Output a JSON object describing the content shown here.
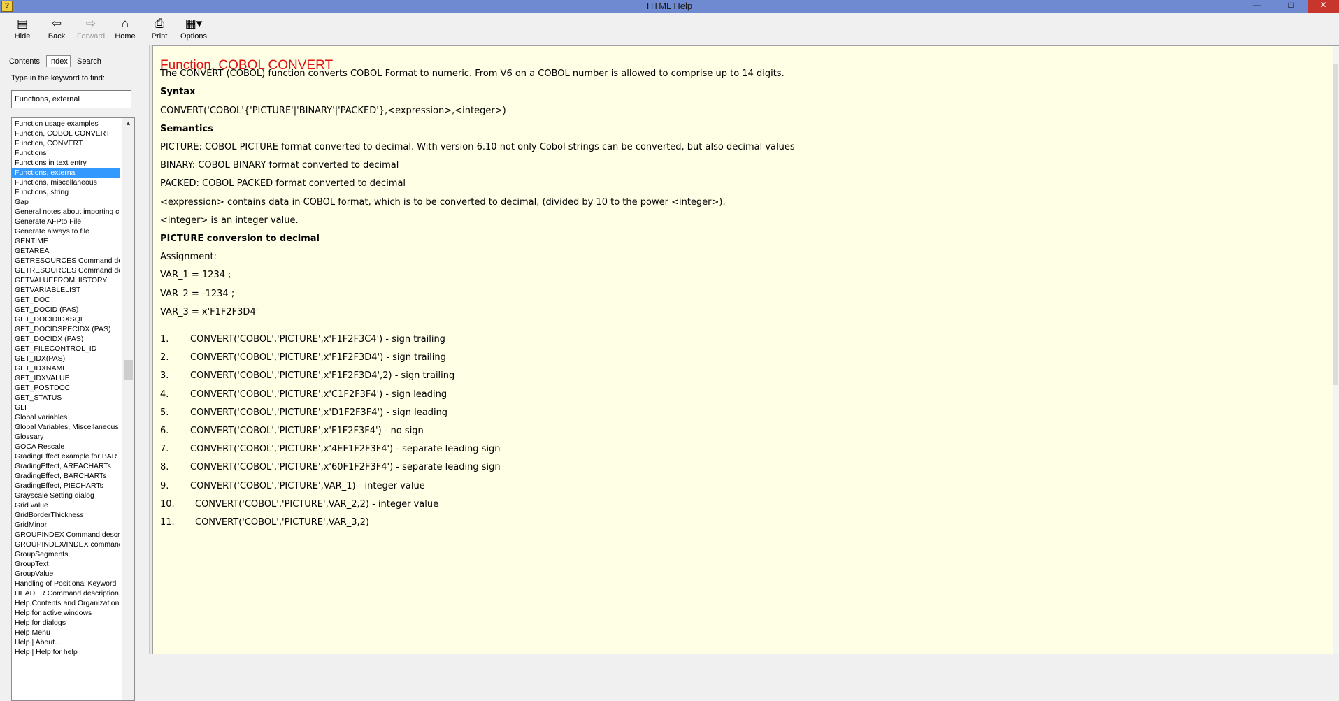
{
  "window": {
    "title": "HTML Help"
  },
  "toolbar": {
    "buttons": [
      "Hide",
      "Back",
      "Forward",
      "Home",
      "Print",
      "Options"
    ]
  },
  "tabs": [
    "Contents",
    "Index",
    "Search"
  ],
  "index": {
    "prompt": "Type in the keyword to find:",
    "keyword": "Functions, external",
    "items": [
      "Function usage examples",
      "Function, COBOL CONVERT",
      "Function, CONVERT",
      "Functions",
      "Functions in text entry",
      "Functions, external",
      "Functions, miscellaneous",
      "Functions, string",
      "Gap",
      "General notes about importing c",
      "Generate AFPto File",
      "Generate always to file",
      "GENTIME",
      "GETAREA",
      "GETRESOURCES Command def",
      "GETRESOURCES Command des",
      "GETVALUEFROMHISTORY",
      "GETVARIABLELIST",
      "GET_DOC",
      "GET_DOCID (PAS)",
      "GET_DOCIDIDXSQL",
      "GET_DOCIDSPECIDX (PAS)",
      "GET_DOCIDX (PAS)",
      "GET_FILECONTROL_ID",
      "GET_IDX(PAS)",
      "GET_IDXNAME",
      "GET_IDXVALUE",
      "GET_POSTDOC",
      "GET_STATUS",
      "GLI",
      "Global variables",
      "Global Variables, Miscellaneous",
      "Glossary",
      "GOCA Rescale",
      "GradingEffect example for BAR",
      "GradingEffect, AREACHARTs",
      "GradingEffect, BARCHARTs",
      "GradingEffect, PIECHARTs",
      "Grayscale Setting dialog",
      "Grid value",
      "GridBorderThickness",
      "GridMinor",
      "GROUPINDEX Command descrip",
      "GROUPINDEX/INDEX command d",
      "GroupSegments",
      "GroupText",
      "GroupValue",
      "Handling of Positional Keyword",
      "HEADER Command description",
      "Help Contents and Organization",
      "Help for active windows",
      "Help for dialogs",
      "Help Menu",
      "Help | About...",
      "Help | Help for help"
    ],
    "selected": "Functions, external"
  },
  "content": {
    "title": "Function, COBOL CONVERT",
    "intro": "The CONVERT (COBOL) function converts COBOL Format to numeric. From V6 on a COBOL number is allowed to comprise up to 14 digits.",
    "syntax_heading": "Syntax",
    "syntax": "CONVERT('COBOL'{'PICTURE'|'BINARY'|'PACKED'},<expression>,<integer>)",
    "semantics_heading": "Semantics",
    "semantics": [
      "PICTURE: COBOL PICTURE format converted to decimal. With version 6.10 not only Cobol strings can be converted, but also decimal values",
      "BINARY: COBOL BINARY format converted to decimal",
      "PACKED: COBOL PACKED format converted to decimal",
      "<expression> contains data in COBOL format, which is to be converted to decimal, (divided by 10 to the power <integer>).",
      "<integer> is an integer value."
    ],
    "picture_heading": "PICTURE conversion to decimal",
    "assignment_label": "Assignment:",
    "assignments": [
      "VAR_1 = 1234 ;",
      "VAR_2 = -1234 ;",
      "VAR_3 = x'F1F2F3D4'"
    ],
    "examples": [
      {
        "num": "1.",
        "text": "CONVERT('COBOL','PICTURE',x'F1F2F3C4') - sign trailing"
      },
      {
        "num": "2.",
        "text": "CONVERT('COBOL','PICTURE',x'F1F2F3D4') - sign trailing"
      },
      {
        "num": "3.",
        "text": "CONVERT('COBOL','PICTURE',x'F1F2F3D4',2) - sign trailing"
      },
      {
        "num": "4.",
        "text": "CONVERT('COBOL','PICTURE',x'C1F2F3F4') - sign leading"
      },
      {
        "num": "5.",
        "text": "CONVERT('COBOL','PICTURE',x'D1F2F3F4') - sign leading"
      },
      {
        "num": "6.",
        "text": "CONVERT('COBOL','PICTURE',x'F1F2F3F4') - no sign"
      },
      {
        "num": "7.",
        "text": "CONVERT('COBOL','PICTURE',x'4EF1F2F3F4') - separate leading sign"
      },
      {
        "num": "8.",
        "text": "CONVERT('COBOL','PICTURE',x'60F1F2F3F4') - separate leading sign"
      },
      {
        "num": "9.",
        "text": "CONVERT('COBOL','PICTURE',VAR_1) - integer value"
      },
      {
        "num": "10.",
        "text": "CONVERT('COBOL','PICTURE',VAR_2,2) - integer value"
      },
      {
        "num": "11.",
        "text": "CONVERT('COBOL','PICTURE',VAR_3,2)"
      }
    ]
  }
}
